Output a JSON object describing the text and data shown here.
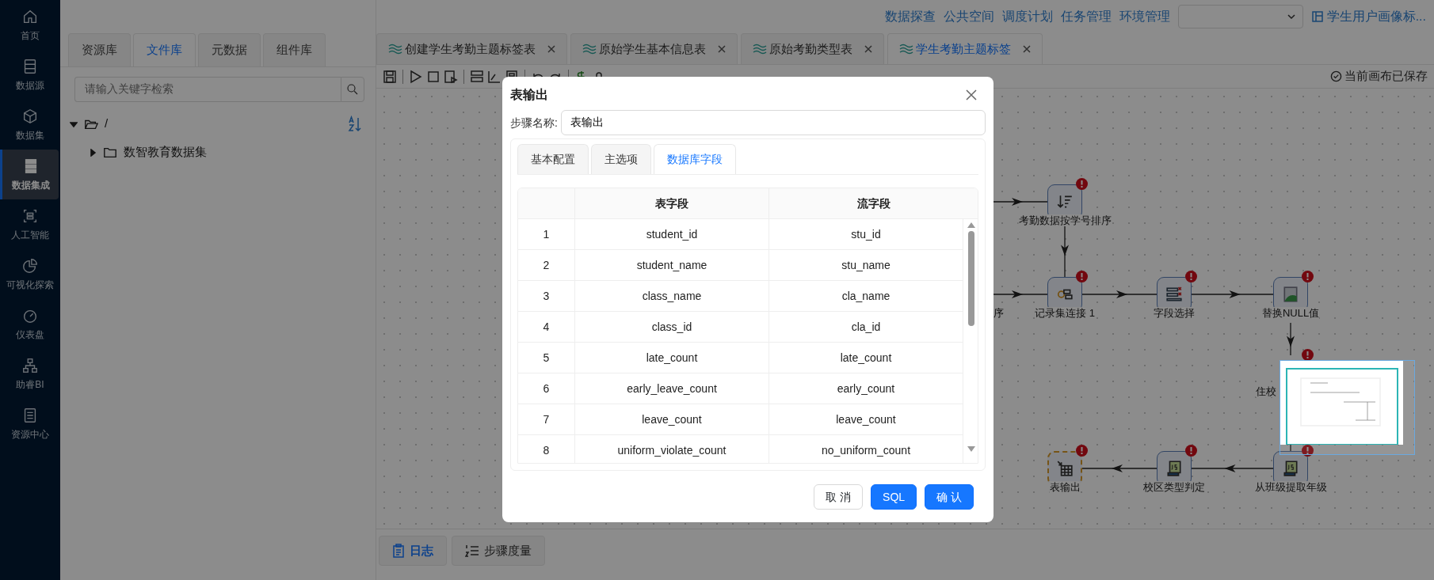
{
  "sidebar": {
    "items": [
      {
        "label": "首页",
        "selected": false
      },
      {
        "label": "数据源",
        "selected": false
      },
      {
        "label": "数据集",
        "selected": false
      },
      {
        "label": "数据集成",
        "selected": true
      },
      {
        "label": "人工智能",
        "selected": false
      },
      {
        "label": "可视化探索",
        "selected": false
      },
      {
        "label": "仪表盘",
        "selected": false
      },
      {
        "label": "助睿BI",
        "selected": false
      },
      {
        "label": "资源中心",
        "selected": false
      }
    ]
  },
  "left_panel": {
    "tabs": [
      {
        "label": "资源库",
        "selected": false
      },
      {
        "label": "文件库",
        "selected": true
      },
      {
        "label": "元数据",
        "selected": false
      },
      {
        "label": "组件库",
        "selected": false
      }
    ],
    "search": {
      "placeholder": "请输入关键字检索"
    },
    "tree": [
      {
        "label": "/",
        "expanded": true,
        "children": [
          {
            "label": "数智教育数据集",
            "expanded": false
          }
        ]
      }
    ]
  },
  "top_nav": {
    "links": [
      "数据探查",
      "公共空间",
      "调度计划",
      "任务管理",
      "环境管理"
    ],
    "project": "学生用户画像标..."
  },
  "editor_tabs": [
    {
      "label": "创建学生考勤主题标签表",
      "selected": false
    },
    {
      "label": "原始学生基本信息表",
      "selected": false
    },
    {
      "label": "原始考勤类型表",
      "selected": false
    },
    {
      "label": "学生考勤主题标签",
      "selected": true
    }
  ],
  "save_status": "当前画布已保存",
  "canvas": {
    "nodes": [
      {
        "label": "考勤数据按学号排序",
        "kind": "sort",
        "error": true,
        "selected": false
      },
      {
        "label": "序",
        "kind": "label_only"
      },
      {
        "label": "记录集连接 1",
        "kind": "join",
        "error": true,
        "selected": false
      },
      {
        "label": "字段选择",
        "kind": "select",
        "error": true,
        "selected": false
      },
      {
        "label": "替换NULL值",
        "kind": "image",
        "error": true,
        "selected": false
      },
      {
        "label": "住校",
        "kind": "covered",
        "error": true
      },
      {
        "label": "表输出",
        "kind": "table_out",
        "error": true,
        "selected": true
      },
      {
        "label": "校区类型判定",
        "kind": "js",
        "error": true,
        "selected": false
      },
      {
        "label": "从班级提取年级",
        "kind": "js",
        "error": true,
        "selected": false
      }
    ]
  },
  "bottom_tabs": [
    {
      "label": "日志",
      "selected": true
    },
    {
      "label": "步骤度量",
      "selected": false
    }
  ],
  "dialog": {
    "title": "表输出",
    "step_name_label": "步骤名称:",
    "step_name_value": "表输出",
    "tabs": [
      {
        "label": "基本配置",
        "selected": false
      },
      {
        "label": "主选项",
        "selected": false
      },
      {
        "label": "数据库字段",
        "selected": true
      }
    ],
    "table": {
      "columns": [
        "",
        "表字段",
        "流字段"
      ],
      "rows": [
        [
          "1",
          "student_id",
          "stu_id"
        ],
        [
          "2",
          "student_name",
          "stu_name"
        ],
        [
          "3",
          "class_name",
          "cla_name"
        ],
        [
          "4",
          "class_id",
          "cla_id"
        ],
        [
          "5",
          "late_count",
          "late_count"
        ],
        [
          "6",
          "early_leave_count",
          "early_count"
        ],
        [
          "7",
          "leave_count",
          "leave_count"
        ],
        [
          "8",
          "uniform_violate_count",
          "no_uniform_count"
        ]
      ]
    },
    "buttons": [
      {
        "label": "取 消",
        "kind": "default"
      },
      {
        "label": "SQL",
        "kind": "primary"
      },
      {
        "label": "确 认",
        "kind": "primary"
      }
    ]
  }
}
